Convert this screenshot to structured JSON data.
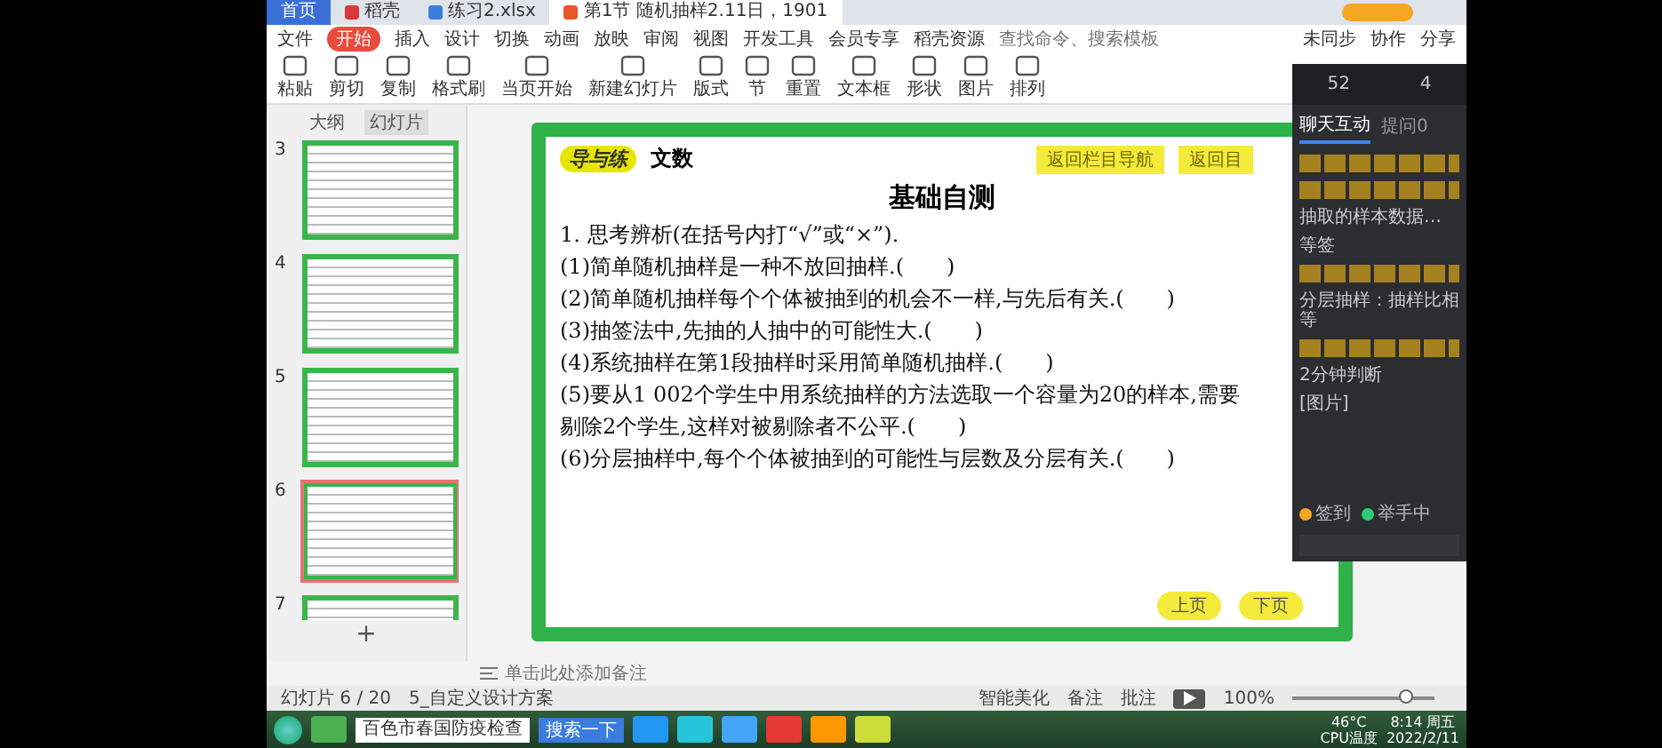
{
  "tabs": [
    {
      "label": "首页",
      "kind": "home",
      "selected": false
    },
    {
      "label": "稻壳",
      "kind": "doc",
      "selected": false
    },
    {
      "label": "练习2.xlsx",
      "kind": "sheet",
      "selected": false
    },
    {
      "label": "第1节  随机抽样2.11日，1901",
      "kind": "slides",
      "selected": true
    }
  ],
  "menu": {
    "file": "文件",
    "items": [
      {
        "label": "开始",
        "selected": true
      },
      {
        "label": "插入",
        "selected": false
      },
      {
        "label": "设计",
        "selected": false
      },
      {
        "label": "切换",
        "selected": false
      },
      {
        "label": "动画",
        "selected": false
      },
      {
        "label": "放映",
        "selected": false
      },
      {
        "label": "审阅",
        "selected": false
      },
      {
        "label": "视图",
        "selected": false
      },
      {
        "label": "开发工具",
        "selected": false
      },
      {
        "label": "会员专享",
        "selected": false
      },
      {
        "label": "稻壳资源",
        "selected": false
      }
    ],
    "search": {
      "placeholder": "查找命令、搜索模板"
    },
    "actions": [
      "未同步",
      "协作",
      "分享"
    ]
  },
  "toolbar": [
    "粘贴",
    "剪切",
    "复制",
    "格式刷",
    "当页开始",
    "新建幻灯片",
    "版式",
    "节",
    "重置",
    "文本框",
    "形状",
    "图片",
    "排列"
  ],
  "panel": {
    "tabs": [
      {
        "label": "大纲",
        "selected": false
      },
      {
        "label": "幻灯片",
        "selected": true
      }
    ],
    "slides": [
      {
        "number": "3",
        "selected": false
      },
      {
        "number": "4",
        "selected": false
      },
      {
        "number": "5",
        "selected": false
      },
      {
        "number": "6",
        "selected": true
      },
      {
        "number": "7",
        "selected": false
      }
    ],
    "add": "+"
  },
  "slide": {
    "logo": "导与练",
    "subject": "文数",
    "nav_buttons": [
      "返回栏目导航",
      "返回目"
    ],
    "title": "基础自测",
    "lines": [
      "1. 思考辨析(在括号内打“√”或“×”).",
      "(1)简单随机抽样是一种不放回抽样.(　　)",
      "(2)简单随机抽样每个个体被抽到的机会不一样,与先后有关.(　　)",
      "(3)抽签法中,先抽的人抽中的可能性大.(　　)",
      "(4)系统抽样在第1段抽样时采用简单随机抽样.(　　)",
      "(5)要从1 002个学生中用系统抽样的方法选取一个容量为20的样本,需要剔除2个学生,这样对被剔除者不公平.(　　)",
      "(6)分层抽样中,每个个体被抽到的可能性与层数及分层有关.(　　)"
    ],
    "pager": [
      "上页",
      "下页"
    ]
  },
  "chat": {
    "stats": [
      "52",
      "4"
    ],
    "tabs": [
      {
        "label": "聊天互动",
        "selected": true
      },
      {
        "label": "提问0",
        "selected": false
      }
    ],
    "messages": [
      {
        "kind": "notice"
      },
      {
        "kind": "notice"
      },
      {
        "kind": "text",
        "text": "抽取的样本数据…"
      },
      {
        "kind": "text",
        "text": "等签"
      },
      {
        "kind": "notice"
      },
      {
        "kind": "text",
        "text": "分层抽样：抽样比相等"
      },
      {
        "kind": "notice"
      },
      {
        "kind": "text",
        "text": "2分钟判断"
      },
      {
        "kind": "text",
        "text": "[图片]"
      }
    ],
    "legend": [
      {
        "label": "签到",
        "color": "#f5a623"
      },
      {
        "label": "举手中",
        "color": "#2ecc71"
      }
    ]
  },
  "notes": {
    "placeholder": "单击此处添加备注"
  },
  "status": {
    "slide_count": "幻灯片 6 / 20",
    "theme": "5_自定义设计方案",
    "tools": [
      "智能美化",
      "备注",
      "批注"
    ],
    "zoom": "100%",
    "level": 0.8
  },
  "taskbar": {
    "search": {
      "value": "百色市春国防疫检查",
      "button": "搜索一下"
    },
    "temp": "46°C",
    "temp_label": "CPU温度",
    "time": "8:14 周五",
    "date": "2022/2/11"
  }
}
